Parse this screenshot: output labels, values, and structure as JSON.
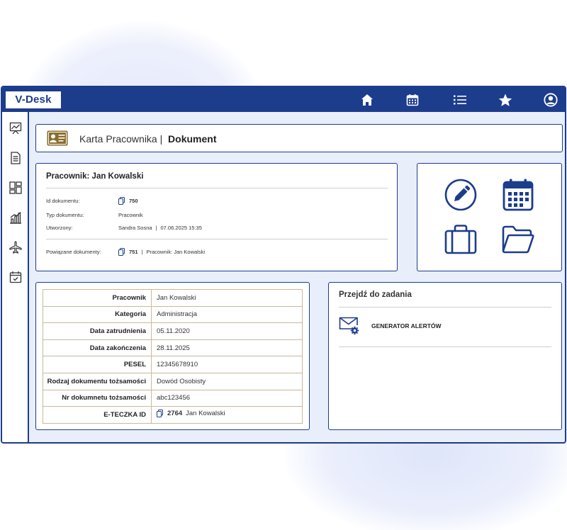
{
  "app": {
    "logo": "V-Desk"
  },
  "topnav": [
    {
      "name": "home-icon"
    },
    {
      "name": "calendar-icon"
    },
    {
      "name": "list-icon"
    },
    {
      "name": "star-icon"
    },
    {
      "name": "user-icon"
    }
  ],
  "sidebar": [
    {
      "name": "chart-board-icon"
    },
    {
      "name": "document-icon"
    },
    {
      "name": "dashboard-icon"
    },
    {
      "name": "bar-chart-icon"
    },
    {
      "name": "airplane-icon"
    },
    {
      "name": "calendar-check-icon"
    }
  ],
  "header": {
    "prefix": "Karta Pracownika |",
    "title": "Dokument"
  },
  "document": {
    "employee_title": "Pracownik: Jan Kowalski",
    "id_label": "Id dokumentu:",
    "id_value": "750",
    "type_label": "Typ dokumentu:",
    "type_value": "Pracownik",
    "created_label": "Utworzony:",
    "created_by": "Sandra Sosna",
    "created_sep": "|",
    "created_at": "07.06.2025 15:35",
    "related_label": "Powiązane dokumenty:",
    "related_id": "751",
    "related_sep": "|",
    "related_name": "Pracownik: Jan Kowalski"
  },
  "actions": [
    {
      "name": "edit-icon"
    },
    {
      "name": "calendar-grid-icon"
    },
    {
      "name": "briefcase-icon"
    },
    {
      "name": "folder-icon"
    }
  ],
  "details": [
    {
      "key": "Pracownik",
      "value": "Jan Kowalski"
    },
    {
      "key": "Kategoria",
      "value": "Administracja"
    },
    {
      "key": "Data zatrudnienia",
      "value": "05.11.2020"
    },
    {
      "key": "Data zakończenia",
      "value": "28.11.2025"
    },
    {
      "key": "PESEL",
      "value": "12345678910"
    },
    {
      "key": "Rodzaj dokumentu tożsamości",
      "value": "Dowód Osobisty"
    },
    {
      "key": "Nr dokumnetu tożsamości",
      "value": "abc123456"
    },
    {
      "key": "E-TECZKA ID",
      "value_id": "2764",
      "value": "Jan Kowalski"
    }
  ],
  "tasks": {
    "title": "Przejdź do zadania",
    "items": [
      {
        "label": "GENERATOR ALERTÓW",
        "icon": "mail-gear-icon"
      }
    ]
  },
  "colors": {
    "primary": "#1c3c8c",
    "badge": "#8a6d2b",
    "background": "#e9eefb"
  }
}
